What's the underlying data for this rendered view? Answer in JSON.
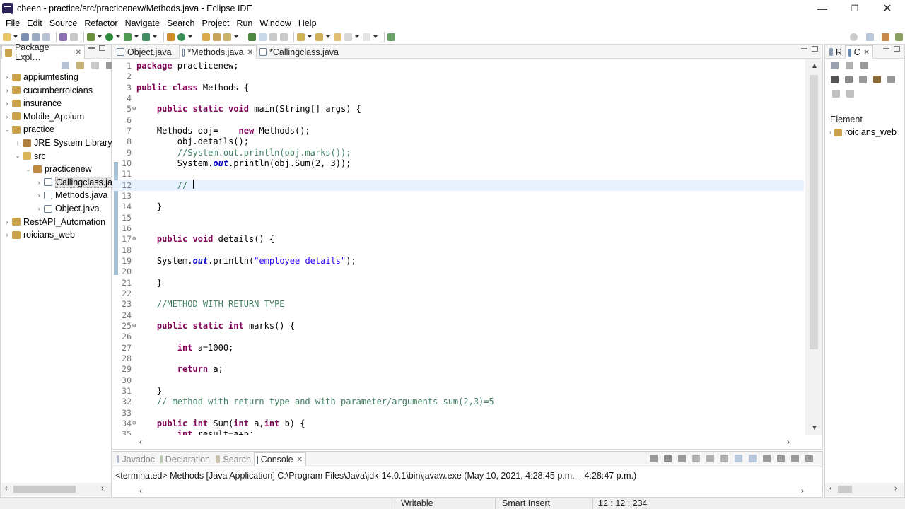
{
  "window": {
    "title": "cheen - practice/src/practicenew/Methods.java - Eclipse IDE",
    "min": "—",
    "max": "❐",
    "close": "✕"
  },
  "menu": [
    "File",
    "Edit",
    "Source",
    "Refactor",
    "Navigate",
    "Search",
    "Project",
    "Run",
    "Window",
    "Help"
  ],
  "package_explorer": {
    "title": "Package Expl…",
    "items": [
      {
        "label": "appiumtesting",
        "level": 0,
        "expanded": false,
        "icon": "project-icon"
      },
      {
        "label": "cucumberroicians",
        "level": 0,
        "expanded": false,
        "icon": "project-icon"
      },
      {
        "label": "insurance",
        "level": 0,
        "expanded": false,
        "icon": "project-icon"
      },
      {
        "label": "Mobile_Appium",
        "level": 0,
        "expanded": false,
        "icon": "project-icon"
      },
      {
        "label": "practice",
        "level": 0,
        "expanded": true,
        "icon": "project-icon"
      },
      {
        "label": "JRE System Library [",
        "level": 1,
        "expanded": false,
        "icon": "library-icon"
      },
      {
        "label": "src",
        "level": 1,
        "expanded": true,
        "icon": "folder-icon"
      },
      {
        "label": "practicenew",
        "level": 2,
        "expanded": true,
        "icon": "package-icon"
      },
      {
        "label": "Callingclass.ja",
        "level": 3,
        "expanded": false,
        "icon": "java-file-icon",
        "selected": true
      },
      {
        "label": "Methods.java",
        "level": 3,
        "expanded": false,
        "icon": "java-file-icon"
      },
      {
        "label": "Object.java",
        "level": 3,
        "expanded": false,
        "icon": "java-file-icon"
      },
      {
        "label": "RestAPI_Automation",
        "level": 0,
        "expanded": false,
        "icon": "project-icon"
      },
      {
        "label": "roicians_web",
        "level": 0,
        "expanded": false,
        "icon": "project-icon"
      }
    ]
  },
  "editor_tabs": [
    {
      "label": "Object.java",
      "active": false,
      "closable": false
    },
    {
      "label": "*Methods.java",
      "active": true,
      "closable": true
    },
    {
      "label": "*Callingclass.java",
      "active": false,
      "closable": false
    }
  ],
  "code_lines": [
    {
      "n": "1",
      "html": "<span class=\"kw\">package</span> practicenew;"
    },
    {
      "n": "2",
      "html": ""
    },
    {
      "n": "3",
      "html": "<span class=\"kw\">public class</span> Methods {"
    },
    {
      "n": "4",
      "html": ""
    },
    {
      "n": "5",
      "fold": true,
      "html": "    <span class=\"kw\">public static void</span> main(String[] args) {"
    },
    {
      "n": "6",
      "html": ""
    },
    {
      "n": "7",
      "html": "    Methods obj=    <span class=\"kw\">new</span> Methods();"
    },
    {
      "n": "8",
      "html": "        obj.details();"
    },
    {
      "n": "9",
      "html": "        <span class=\"cm\">//System.out.println(obj.marks());</span>"
    },
    {
      "n": "10",
      "html": "        System.<span class=\"it\">out</span>.println(obj.Sum(2, 3));"
    },
    {
      "n": "11",
      "html": ""
    },
    {
      "n": "12",
      "current": true,
      "html": "        <span class=\"cm\">// </span>"
    },
    {
      "n": "13",
      "html": ""
    },
    {
      "n": "14",
      "html": "    }"
    },
    {
      "n": "15",
      "html": ""
    },
    {
      "n": "16",
      "html": ""
    },
    {
      "n": "17",
      "fold": true,
      "html": "    <span class=\"kw\">public void</span> details() {"
    },
    {
      "n": "18",
      "html": ""
    },
    {
      "n": "19",
      "html": "    System.<span class=\"it\">out</span>.println(<span class=\"str\">\"employee details\"</span>);"
    },
    {
      "n": "20",
      "html": ""
    },
    {
      "n": "21",
      "html": "    }"
    },
    {
      "n": "22",
      "html": ""
    },
    {
      "n": "23",
      "html": "    <span class=\"cm\">//METHOD WITH RETURN TYPE</span>"
    },
    {
      "n": "24",
      "html": ""
    },
    {
      "n": "25",
      "fold": true,
      "html": "    <span class=\"kw\">public static int</span> marks() {"
    },
    {
      "n": "26",
      "html": ""
    },
    {
      "n": "27",
      "html": "        <span class=\"kw\">int</span> a=1000;"
    },
    {
      "n": "28",
      "html": ""
    },
    {
      "n": "29",
      "html": "        <span class=\"kw\">return</span> a;"
    },
    {
      "n": "30",
      "html": ""
    },
    {
      "n": "31",
      "html": "    }"
    },
    {
      "n": "32",
      "html": "    <span class=\"cm\">// method with return type and with parameter/arguments sum(2,3)=5</span>"
    },
    {
      "n": "33",
      "html": ""
    },
    {
      "n": "34",
      "fold": true,
      "html": "    <span class=\"kw\">public int</span> Sum(<span class=\"kw\">int</span> a,<span class=\"kw\">int</span> b) {"
    },
    {
      "n": "35",
      "html": "        <span class=\"kw\">int</span> result=a+b;"
    }
  ],
  "bottom_tabs": [
    {
      "label": "Javadoc",
      "active": false
    },
    {
      "label": "Declaration",
      "active": false
    },
    {
      "label": "Search",
      "active": false
    },
    {
      "label": "Console",
      "active": true
    }
  ],
  "console": {
    "text": "<terminated> Methods [Java Application] C:\\Program Files\\Java\\jdk-14.0.1\\bin\\javaw.exe  (May 10, 2021, 4:28:45 p.m. – 4:28:47 p.m.)"
  },
  "outline": {
    "tab1": "R",
    "tab2": "C",
    "element_label": "Element",
    "item": "roicians_web"
  },
  "status": {
    "writable": "Writable",
    "insert_mode": "Smart Insert",
    "position": "12 : 12 : 234"
  },
  "colors": {
    "keyword": "#7f0055",
    "comment": "#3f7f5f",
    "string": "#2a00ff",
    "field": "#0000c0",
    "current_line": "#e8f2fe"
  }
}
